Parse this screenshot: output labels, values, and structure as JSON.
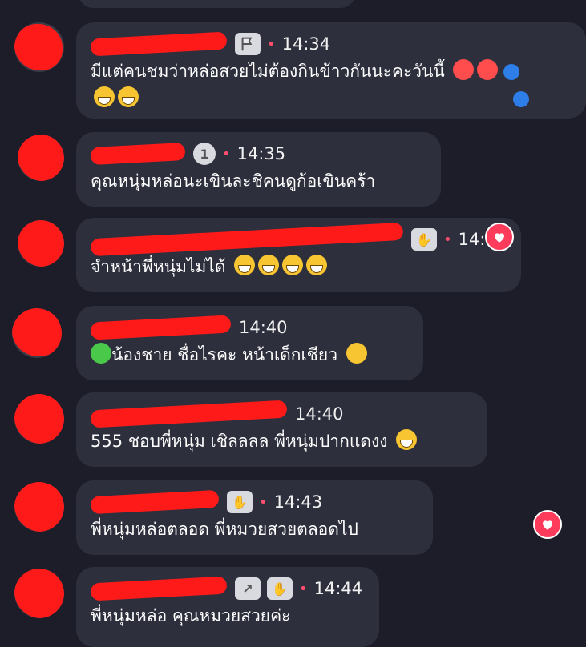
{
  "colors": {
    "background": "#1c1d29",
    "bubble": "#2e2f3d",
    "redaction": "#ff1a1a",
    "heart": "#ff3b5c",
    "like": "#2d7ee8"
  },
  "messages": [
    {
      "badge": "flag-icon",
      "time": "14:34",
      "line1": "มีแต่คนชมว่าหล่อสวยไม่ต้องกินข้าวกันนะคะวันนี้",
      "line2": ""
    },
    {
      "badge_text": "1",
      "time": "14:35",
      "line1": "คุณหนุ่มหล่อนะเขินละชิคนดูก้อเขินคร้า"
    },
    {
      "badge": "wave-icon",
      "time": "14:3",
      "line1": "จำหน้าพี่หนุ่มไม่ได้"
    },
    {
      "time": "14:40",
      "line1": "น้องชาย ชื่อไรคะ หน้าเด็กเชียว"
    },
    {
      "time": "14:40",
      "line1": "555 ชอบพี่หนุ่ม เชิลลลล พี่หนุ่มปากแดงง"
    },
    {
      "badge": "wave-icon",
      "time": "14:43",
      "line1": "พี่หนุ่มหล่อตลอด พี่หมวยสวยตลอดไป"
    },
    {
      "badge": "wave-icon",
      "time": "14:44",
      "line1": "พี่หนุ่มหล่อ คุณหมวยสวยค่ะ"
    }
  ]
}
